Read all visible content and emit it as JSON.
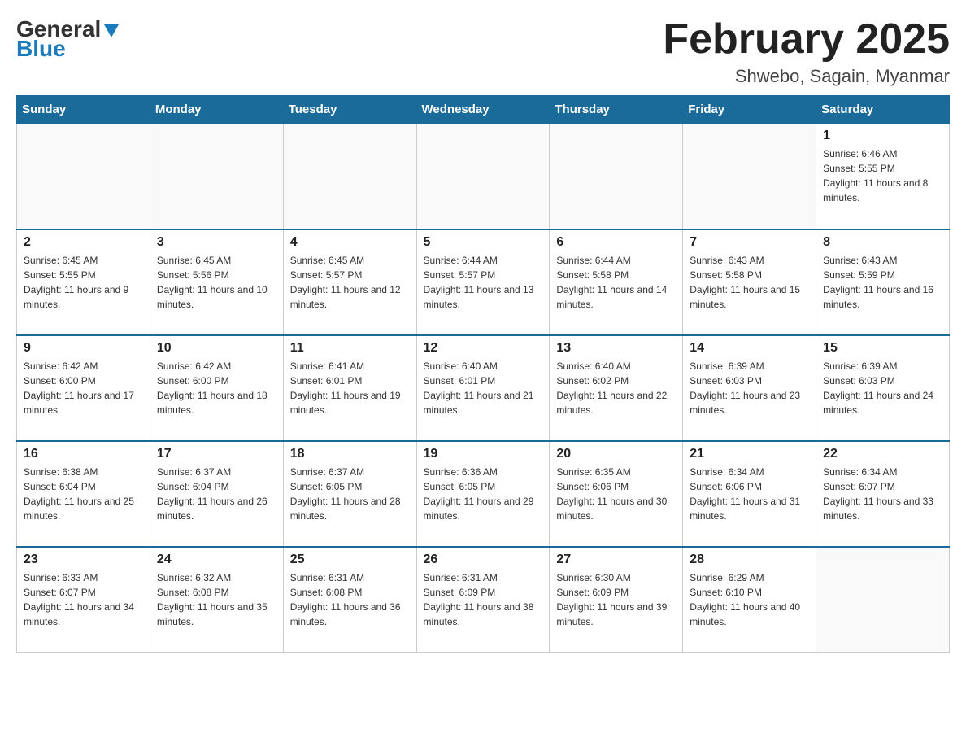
{
  "header": {
    "logo_general": "General",
    "logo_blue": "Blue",
    "month_title": "February 2025",
    "location": "Shwebo, Sagain, Myanmar"
  },
  "weekdays": [
    "Sunday",
    "Monday",
    "Tuesday",
    "Wednesday",
    "Thursday",
    "Friday",
    "Saturday"
  ],
  "weeks": [
    [
      {
        "day": "",
        "sunrise": "",
        "sunset": "",
        "daylight": ""
      },
      {
        "day": "",
        "sunrise": "",
        "sunset": "",
        "daylight": ""
      },
      {
        "day": "",
        "sunrise": "",
        "sunset": "",
        "daylight": ""
      },
      {
        "day": "",
        "sunrise": "",
        "sunset": "",
        "daylight": ""
      },
      {
        "day": "",
        "sunrise": "",
        "sunset": "",
        "daylight": ""
      },
      {
        "day": "",
        "sunrise": "",
        "sunset": "",
        "daylight": ""
      },
      {
        "day": "1",
        "sunrise": "Sunrise: 6:46 AM",
        "sunset": "Sunset: 5:55 PM",
        "daylight": "Daylight: 11 hours and 8 minutes."
      }
    ],
    [
      {
        "day": "2",
        "sunrise": "Sunrise: 6:45 AM",
        "sunset": "Sunset: 5:55 PM",
        "daylight": "Daylight: 11 hours and 9 minutes."
      },
      {
        "day": "3",
        "sunrise": "Sunrise: 6:45 AM",
        "sunset": "Sunset: 5:56 PM",
        "daylight": "Daylight: 11 hours and 10 minutes."
      },
      {
        "day": "4",
        "sunrise": "Sunrise: 6:45 AM",
        "sunset": "Sunset: 5:57 PM",
        "daylight": "Daylight: 11 hours and 12 minutes."
      },
      {
        "day": "5",
        "sunrise": "Sunrise: 6:44 AM",
        "sunset": "Sunset: 5:57 PM",
        "daylight": "Daylight: 11 hours and 13 minutes."
      },
      {
        "day": "6",
        "sunrise": "Sunrise: 6:44 AM",
        "sunset": "Sunset: 5:58 PM",
        "daylight": "Daylight: 11 hours and 14 minutes."
      },
      {
        "day": "7",
        "sunrise": "Sunrise: 6:43 AM",
        "sunset": "Sunset: 5:58 PM",
        "daylight": "Daylight: 11 hours and 15 minutes."
      },
      {
        "day": "8",
        "sunrise": "Sunrise: 6:43 AM",
        "sunset": "Sunset: 5:59 PM",
        "daylight": "Daylight: 11 hours and 16 minutes."
      }
    ],
    [
      {
        "day": "9",
        "sunrise": "Sunrise: 6:42 AM",
        "sunset": "Sunset: 6:00 PM",
        "daylight": "Daylight: 11 hours and 17 minutes."
      },
      {
        "day": "10",
        "sunrise": "Sunrise: 6:42 AM",
        "sunset": "Sunset: 6:00 PM",
        "daylight": "Daylight: 11 hours and 18 minutes."
      },
      {
        "day": "11",
        "sunrise": "Sunrise: 6:41 AM",
        "sunset": "Sunset: 6:01 PM",
        "daylight": "Daylight: 11 hours and 19 minutes."
      },
      {
        "day": "12",
        "sunrise": "Sunrise: 6:40 AM",
        "sunset": "Sunset: 6:01 PM",
        "daylight": "Daylight: 11 hours and 21 minutes."
      },
      {
        "day": "13",
        "sunrise": "Sunrise: 6:40 AM",
        "sunset": "Sunset: 6:02 PM",
        "daylight": "Daylight: 11 hours and 22 minutes."
      },
      {
        "day": "14",
        "sunrise": "Sunrise: 6:39 AM",
        "sunset": "Sunset: 6:03 PM",
        "daylight": "Daylight: 11 hours and 23 minutes."
      },
      {
        "day": "15",
        "sunrise": "Sunrise: 6:39 AM",
        "sunset": "Sunset: 6:03 PM",
        "daylight": "Daylight: 11 hours and 24 minutes."
      }
    ],
    [
      {
        "day": "16",
        "sunrise": "Sunrise: 6:38 AM",
        "sunset": "Sunset: 6:04 PM",
        "daylight": "Daylight: 11 hours and 25 minutes."
      },
      {
        "day": "17",
        "sunrise": "Sunrise: 6:37 AM",
        "sunset": "Sunset: 6:04 PM",
        "daylight": "Daylight: 11 hours and 26 minutes."
      },
      {
        "day": "18",
        "sunrise": "Sunrise: 6:37 AM",
        "sunset": "Sunset: 6:05 PM",
        "daylight": "Daylight: 11 hours and 28 minutes."
      },
      {
        "day": "19",
        "sunrise": "Sunrise: 6:36 AM",
        "sunset": "Sunset: 6:05 PM",
        "daylight": "Daylight: 11 hours and 29 minutes."
      },
      {
        "day": "20",
        "sunrise": "Sunrise: 6:35 AM",
        "sunset": "Sunset: 6:06 PM",
        "daylight": "Daylight: 11 hours and 30 minutes."
      },
      {
        "day": "21",
        "sunrise": "Sunrise: 6:34 AM",
        "sunset": "Sunset: 6:06 PM",
        "daylight": "Daylight: 11 hours and 31 minutes."
      },
      {
        "day": "22",
        "sunrise": "Sunrise: 6:34 AM",
        "sunset": "Sunset: 6:07 PM",
        "daylight": "Daylight: 11 hours and 33 minutes."
      }
    ],
    [
      {
        "day": "23",
        "sunrise": "Sunrise: 6:33 AM",
        "sunset": "Sunset: 6:07 PM",
        "daylight": "Daylight: 11 hours and 34 minutes."
      },
      {
        "day": "24",
        "sunrise": "Sunrise: 6:32 AM",
        "sunset": "Sunset: 6:08 PM",
        "daylight": "Daylight: 11 hours and 35 minutes."
      },
      {
        "day": "25",
        "sunrise": "Sunrise: 6:31 AM",
        "sunset": "Sunset: 6:08 PM",
        "daylight": "Daylight: 11 hours and 36 minutes."
      },
      {
        "day": "26",
        "sunrise": "Sunrise: 6:31 AM",
        "sunset": "Sunset: 6:09 PM",
        "daylight": "Daylight: 11 hours and 38 minutes."
      },
      {
        "day": "27",
        "sunrise": "Sunrise: 6:30 AM",
        "sunset": "Sunset: 6:09 PM",
        "daylight": "Daylight: 11 hours and 39 minutes."
      },
      {
        "day": "28",
        "sunrise": "Sunrise: 6:29 AM",
        "sunset": "Sunset: 6:10 PM",
        "daylight": "Daylight: 11 hours and 40 minutes."
      },
      {
        "day": "",
        "sunrise": "",
        "sunset": "",
        "daylight": ""
      }
    ]
  ]
}
